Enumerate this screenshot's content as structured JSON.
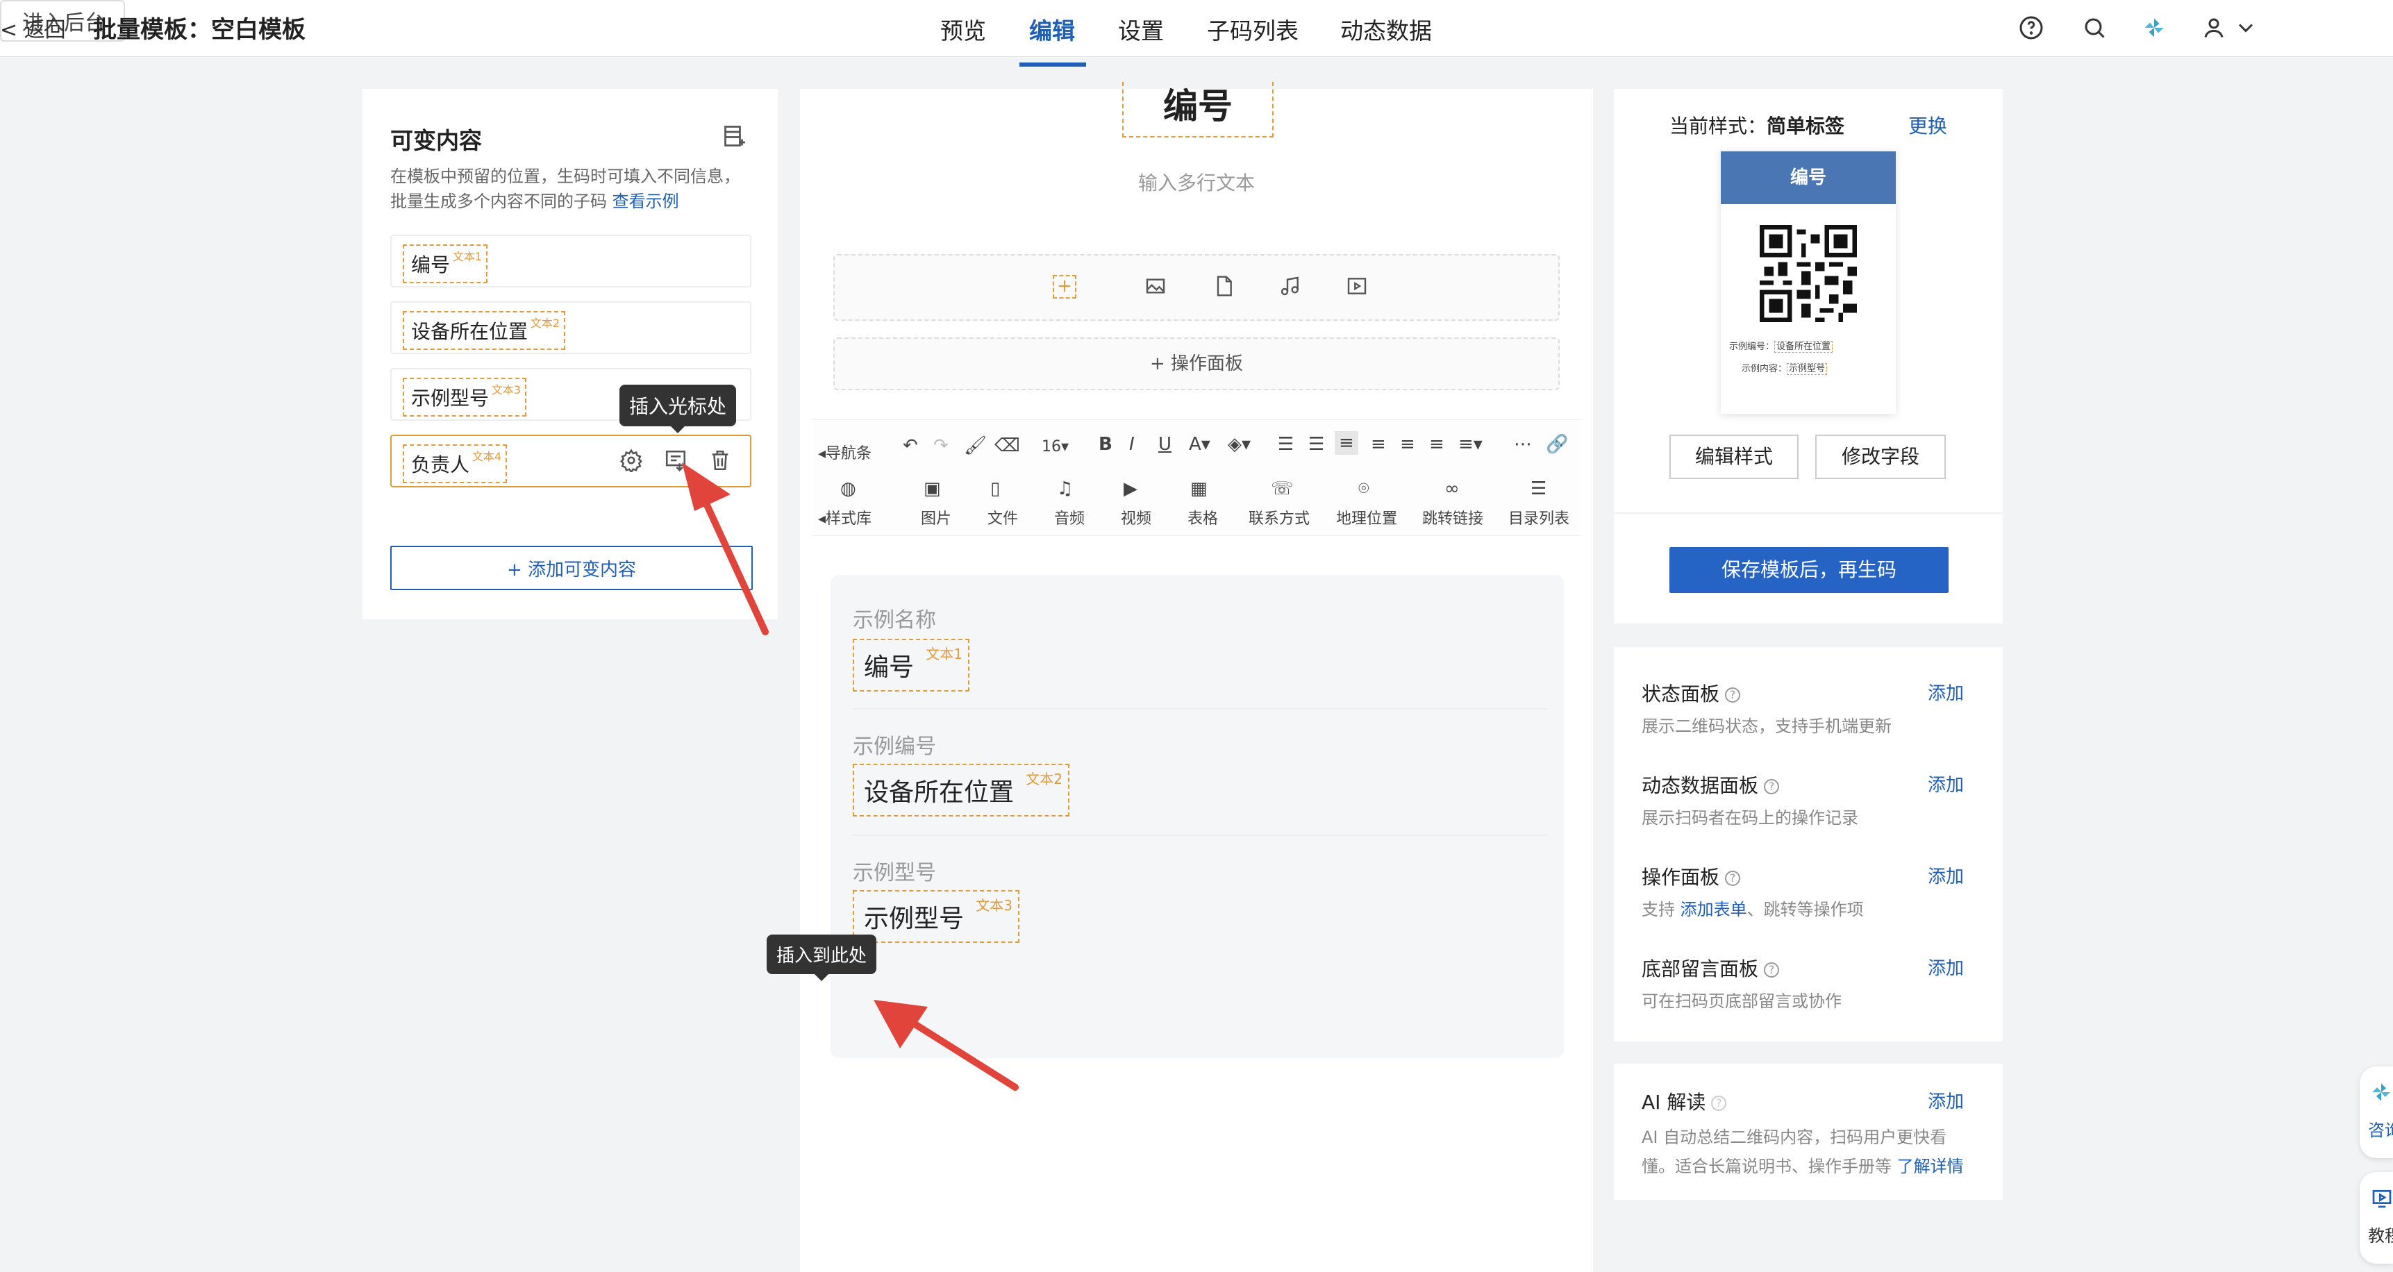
{
  "header": {
    "back_label": "返回",
    "title": "批量模板：空白模板",
    "tabs": [
      {
        "label": "预览"
      },
      {
        "label": "编辑"
      },
      {
        "label": "设置"
      },
      {
        "label": "子码列表"
      },
      {
        "label": "动态数据"
      }
    ],
    "enter_admin": "进入后台"
  },
  "left_panel": {
    "title": "可变内容",
    "desc_line1": "在模板中预留的位置，生码时可填入不同信息，",
    "desc_line2": "批量生成多个内容不同的子码",
    "view_example": "查看示例",
    "items": [
      {
        "label": "编号",
        "tag": "文本1"
      },
      {
        "label": "设备所在位置",
        "tag": "文本2"
      },
      {
        "label": "示例型号",
        "tag": "文本3"
      },
      {
        "label": "负责人",
        "tag": "文本4"
      }
    ],
    "tooltip": "插入光标处",
    "add_button": "+ 添加可变内容"
  },
  "editor": {
    "top_field": "编号",
    "multiline_placeholder": "输入多行文本",
    "operation_panel": "+ 操作面板",
    "toolbar_nav": "导航条",
    "font_size": "16",
    "style_lib": "样式库",
    "insert_items": [
      {
        "label": "图片"
      },
      {
        "label": "文件"
      },
      {
        "label": "音频"
      },
      {
        "label": "视频"
      },
      {
        "label": "表格"
      },
      {
        "label": "联系方式"
      },
      {
        "label": "地理位置"
      },
      {
        "label": "跳转链接"
      },
      {
        "label": "目录列表"
      }
    ],
    "card_fields": [
      {
        "label": "示例名称",
        "value": "编号",
        "tag": "文本1"
      },
      {
        "label": "示例编号",
        "value": "设备所在位置",
        "tag": "文本2"
      },
      {
        "label": "示例型号",
        "value": "示例型号",
        "tag": "文本3"
      }
    ],
    "tooltip": "插入到此处"
  },
  "right_panel": {
    "current_style_prefix": "当前样式：",
    "current_style_name": "简单标签",
    "change": "更换",
    "preview_header": "编号",
    "preview_line1_label": "示例编号：",
    "preview_line1_value": "设备所在位置",
    "preview_line2_label": "示例内容：",
    "preview_line2_value": "示例型号",
    "edit_style": "编辑样式",
    "edit_fields": "修改字段",
    "save_button": "保存模板后，再生码",
    "add_panels": [
      {
        "title": "状态面板",
        "desc": "展示二维码状态，支持手机端更新",
        "add": "添加"
      },
      {
        "title": "动态数据面板",
        "desc": "展示扫码者在码上的操作记录",
        "add": "添加"
      },
      {
        "title": "操作面板",
        "desc_prefix": "支持 ",
        "desc_link": "添加表单",
        "desc_suffix": "、跳转等操作项",
        "add": "添加"
      },
      {
        "title": "底部留言面板",
        "desc": "可在扫码页底部留言或协作",
        "add": "添加"
      }
    ],
    "ai": {
      "title": "AI 解读",
      "add": "添加",
      "desc_line1": "AI 自动总结二维码内容，扫码用户更快看",
      "desc_line2": "懂。适合长篇说明书、操作手册等",
      "learn_more": "了解详情"
    }
  },
  "floating": {
    "consult": "咨询",
    "tutorial": "教程"
  },
  "colors": {
    "accent": "#1f5fb5",
    "tag": "#e39a3a",
    "arrow": "#e0443a"
  }
}
